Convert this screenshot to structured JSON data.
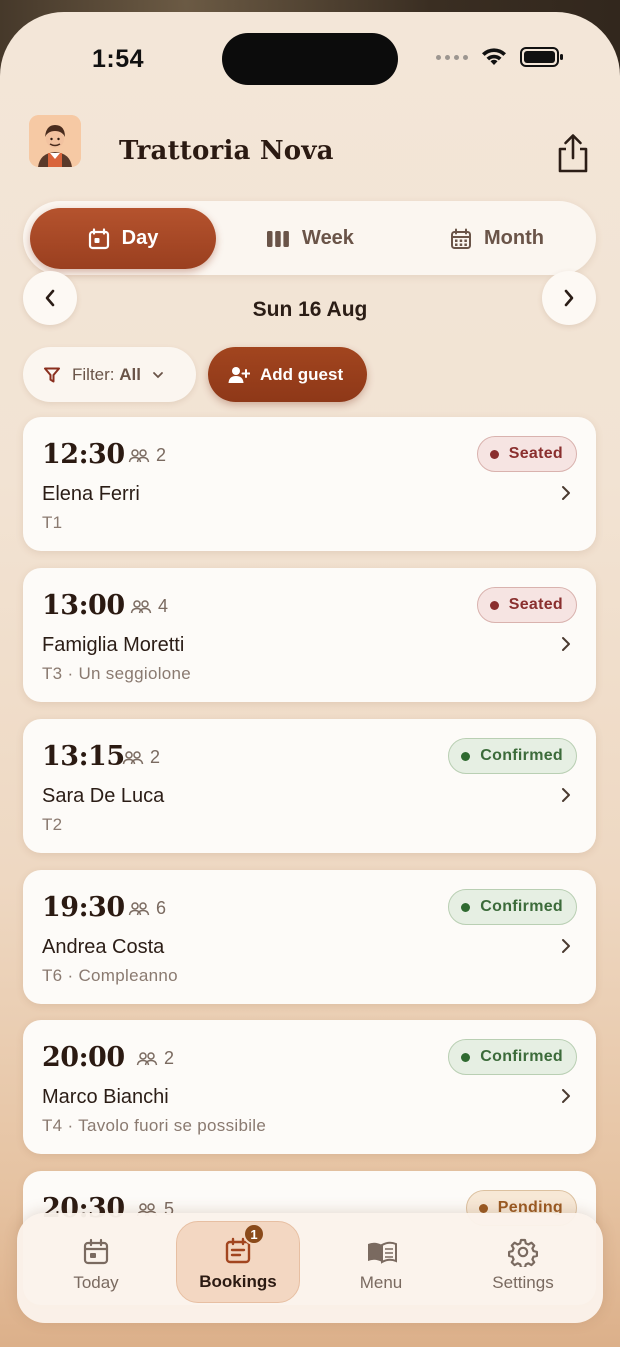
{
  "status_bar": {
    "time": "1:54"
  },
  "header": {
    "title": "Trattoria Nova",
    "avatar_icon": "chef-avatar-icon",
    "share_icon": "share-icon"
  },
  "view_switcher": {
    "selected": "Day",
    "options": [
      {
        "label": "Day",
        "icon": "calendar-day-icon"
      },
      {
        "label": "Week",
        "icon": "week-columns-icon"
      },
      {
        "label": "Month",
        "icon": "calendar-month-icon"
      }
    ]
  },
  "date_nav": {
    "label": "Sun 16 Aug"
  },
  "filter": {
    "label": "Filter:",
    "value": "All"
  },
  "add_guest": {
    "label": "Add guest"
  },
  "bookings": [
    {
      "time": "12:30",
      "party": "2",
      "name": "Elena Ferri",
      "note": "T1",
      "status": "Seated",
      "status_kind": "seated"
    },
    {
      "time": "13:00",
      "party": "4",
      "name": "Famiglia Moretti",
      "note": "T3 · Un seggiolone",
      "status": "Seated",
      "status_kind": "seated"
    },
    {
      "time": "13:15",
      "party": "2",
      "name": "Sara De Luca",
      "note": "T2",
      "status": "Confirmed",
      "status_kind": "confirmed"
    },
    {
      "time": "19:30",
      "party": "6",
      "name": "Andrea Costa",
      "note": "T6 · Compleanno",
      "status": "Confirmed",
      "status_kind": "confirmed"
    },
    {
      "time": "20:00",
      "party": "2",
      "name": "Marco Bianchi",
      "note": "T4 · Tavolo fuori se possibile",
      "status": "Confirmed",
      "status_kind": "confirmed"
    },
    {
      "time": "20:30",
      "party": "5",
      "name": "",
      "note": "",
      "status": "Pending",
      "status_kind": "pending"
    }
  ],
  "tabbar": {
    "active": "Bookings",
    "items": [
      {
        "label": "Today",
        "icon": "calendar-today-icon"
      },
      {
        "label": "Bookings",
        "icon": "bookings-list-icon",
        "badge": "1"
      },
      {
        "label": "Menu",
        "icon": "open-book-icon"
      },
      {
        "label": "Settings",
        "icon": "gear-icon"
      }
    ]
  },
  "colors": {
    "accent": "#a2451f",
    "seated": "#8a2f2e",
    "confirmed": "#2f6a30",
    "pending": "#9a5a22",
    "background": "#f3e6d8"
  }
}
